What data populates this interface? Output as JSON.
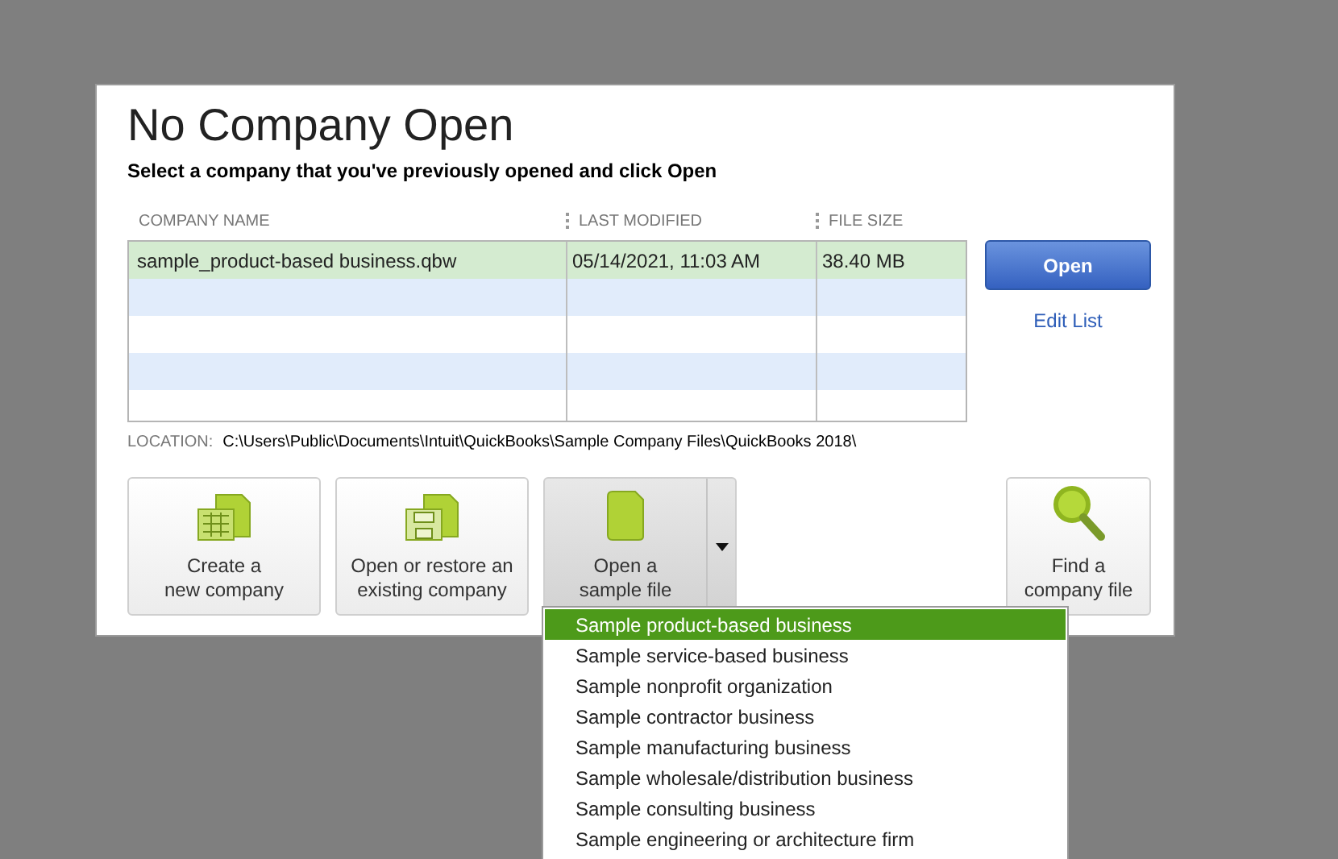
{
  "dialog": {
    "title": "No Company Open",
    "subtitle": "Select a company that you've previously opened and click Open"
  },
  "table": {
    "columns": [
      "COMPANY NAME",
      "LAST MODIFIED",
      "FILE SIZE"
    ],
    "rows": [
      {
        "cells": [
          "sample_product-based business.qbw",
          "05/14/2021, 11:03 AM",
          "38.40 MB"
        ],
        "selected": true
      }
    ]
  },
  "open_button": "Open",
  "edit_list_link": "Edit List",
  "location": {
    "label": "LOCATION:",
    "value": "C:\\Users\\Public\\Documents\\Intuit\\QuickBooks\\Sample Company Files\\QuickBooks 2018\\"
  },
  "actions": [
    {
      "kind": "create",
      "label": [
        "Create a",
        "new company"
      ],
      "pressed": false
    },
    {
      "kind": "restore",
      "label": [
        "Open or restore an",
        "existing company"
      ],
      "pressed": false
    },
    {
      "kind": "sample",
      "label": [
        "Open a",
        "sample file"
      ],
      "pressed": true
    },
    {
      "kind": "find",
      "label": [
        "Find a",
        "company file"
      ],
      "pressed": false
    }
  ],
  "sample_menu": {
    "items": [
      {
        "label": "Sample product-based business",
        "selected": true
      },
      {
        "label": "Sample service-based business",
        "selected": false
      },
      {
        "label": "Sample nonprofit organization",
        "selected": false
      },
      {
        "label": "Sample contractor business",
        "selected": false
      },
      {
        "label": "Sample manufacturing business",
        "selected": false
      },
      {
        "label": "Sample wholesale/distribution business",
        "selected": false
      },
      {
        "label": "Sample consulting business",
        "selected": false
      },
      {
        "label": "Sample engineering or architecture firm",
        "selected": false
      }
    ]
  }
}
